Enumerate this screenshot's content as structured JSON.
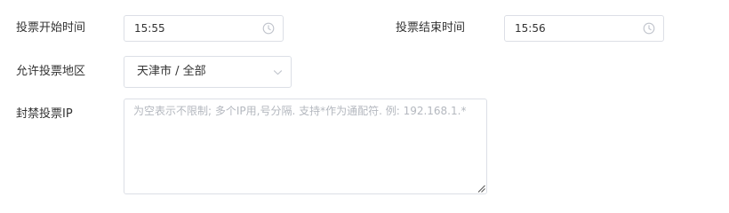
{
  "vote_start": {
    "label": "投票开始时间",
    "value": "15:55",
    "icon": "clock-icon"
  },
  "vote_end": {
    "label": "投票结束时间",
    "value": "15:56",
    "icon": "clock-icon"
  },
  "allowed_region": {
    "label": "允许投票地区",
    "value": "天津市 / 全部",
    "icon": "chevron-down-icon"
  },
  "blocked_ip": {
    "label": "封禁投票IP",
    "placeholder": "为空表示不限制; 多个IP用,号分隔. 支持*作为通配符. 例: 192.168.1.*"
  },
  "colors": {
    "border": "#dcdfe6",
    "placeholder": "#b4b8bf",
    "text": "#333333",
    "icon": "#c0c4cc"
  }
}
